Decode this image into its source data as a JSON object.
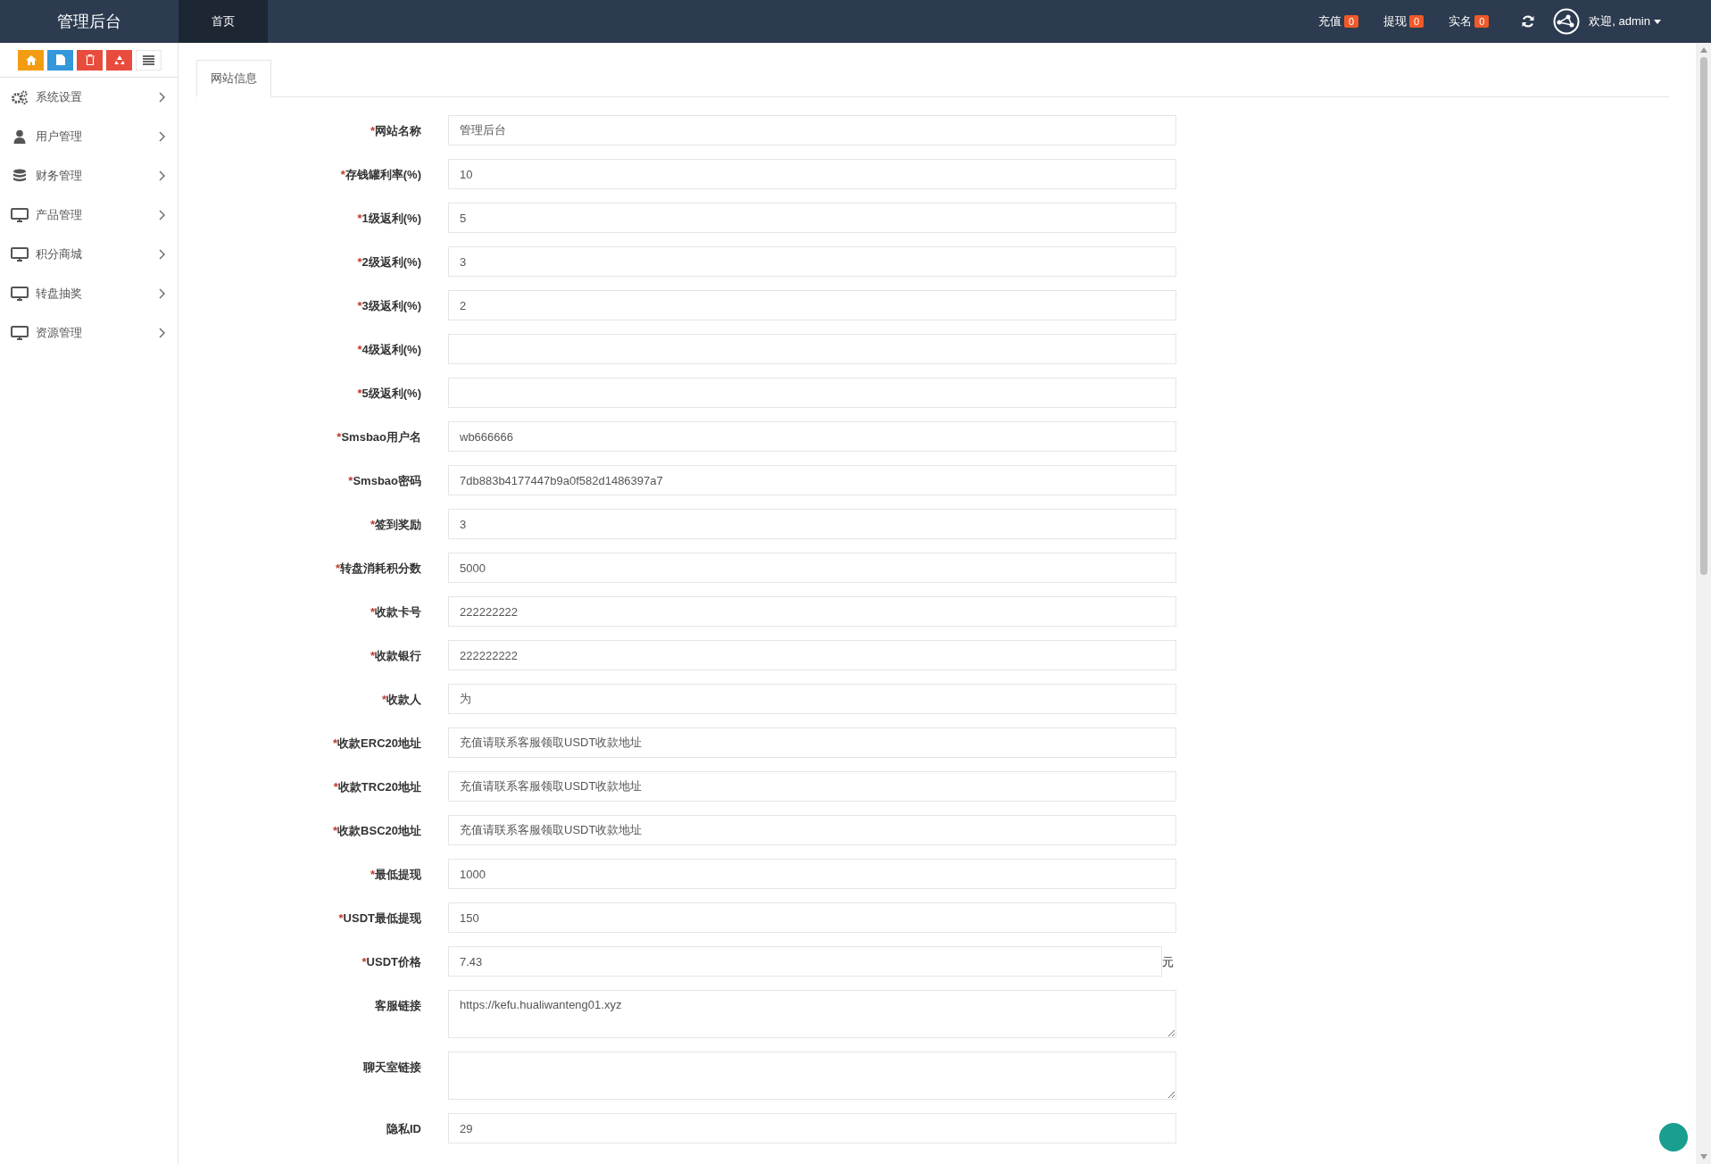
{
  "brand": "管理后台",
  "top_tabs": [
    {
      "label": "首页",
      "selected": true
    }
  ],
  "counters": [
    {
      "label": "充值",
      "count": "0"
    },
    {
      "label": "提现",
      "count": "0"
    },
    {
      "label": "实名",
      "count": "0"
    }
  ],
  "user": {
    "greeting": "欢迎, admin"
  },
  "sidebar": {
    "items": [
      {
        "label": "系统设置"
      },
      {
        "label": "用户管理"
      },
      {
        "label": "财务管理"
      },
      {
        "label": "产品管理"
      },
      {
        "label": "积分商城"
      },
      {
        "label": "转盘抽奖"
      },
      {
        "label": "资源管理"
      }
    ]
  },
  "content_tabs": [
    {
      "label": "网站信息",
      "selected": true
    }
  ],
  "fields": [
    {
      "label": "网站名称",
      "required_mark": "*",
      "kind": "input",
      "value": "管理后台"
    },
    {
      "label": "存钱罐利率(%)",
      "required_mark": "*",
      "kind": "input",
      "value": "10"
    },
    {
      "label": "1级返利(%)",
      "required_mark": "*",
      "kind": "input",
      "value": "5"
    },
    {
      "label": "2级返利(%)",
      "required_mark": "*",
      "kind": "input",
      "value": "3"
    },
    {
      "label": "3级返利(%)",
      "required_mark": "*",
      "kind": "input",
      "value": "2"
    },
    {
      "label": "4级返利(%)",
      "required_mark": "*",
      "kind": "input"
    },
    {
      "label": "5级返利(%)",
      "required_mark": "*",
      "kind": "input"
    },
    {
      "label": "Smsbao用户名",
      "required_mark": "*",
      "kind": "input",
      "value": "wb666666"
    },
    {
      "label": "Smsbao密码",
      "required_mark": "*",
      "kind": "input",
      "value": "7db883b4177447b9a0f582d1486397a7"
    },
    {
      "label": "签到奖励",
      "required_mark": "*",
      "kind": "input",
      "value": "3"
    },
    {
      "label": "转盘消耗积分数",
      "required_mark": "*",
      "kind": "input",
      "value": "5000"
    },
    {
      "label": "收款卡号",
      "required_mark": "*",
      "kind": "input",
      "value": "222222222"
    },
    {
      "label": "收款银行",
      "required_mark": "*",
      "kind": "input",
      "value": "222222222"
    },
    {
      "label": "收款人",
      "required_mark": "*",
      "kind": "input",
      "value": "为"
    },
    {
      "label": "收款ERC20地址",
      "required_mark": "*",
      "kind": "input",
      "value": "充值请联系客服领取USDT收款地址"
    },
    {
      "label": "收款TRC20地址",
      "required_mark": "*",
      "kind": "input",
      "value": "充值请联系客服领取USDT收款地址"
    },
    {
      "label": "收款BSC20地址",
      "required_mark": "*",
      "kind": "input",
      "value": "充值请联系客服领取USDT收款地址"
    },
    {
      "label": "最低提现",
      "required_mark": "*",
      "kind": "input",
      "value": "1000"
    },
    {
      "label": "USDT最低提现",
      "required_mark": "*",
      "kind": "input",
      "value": "150"
    },
    {
      "label": "USDT价格",
      "required_mark": "*",
      "kind": "input",
      "value": "7.43",
      "suffix": "元"
    },
    {
      "label": "客服链接",
      "kind": "textarea",
      "value": "https://kefu.hualiwanteng01.xyz"
    },
    {
      "label": "聊天室链接",
      "kind": "textarea"
    },
    {
      "label": "隐私ID",
      "kind": "input",
      "value": "29"
    }
  ]
}
